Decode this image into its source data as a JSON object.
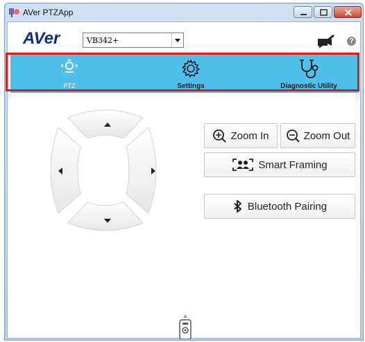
{
  "window": {
    "title": "AVer PTZApp"
  },
  "header": {
    "logo_text": "AVer",
    "device_select": {
      "value": "VB342+"
    },
    "camera_icon": "camera-off-icon",
    "help_label": "?"
  },
  "tabs": [
    {
      "label": "PTZ",
      "icon": "ptz-icon",
      "active": true
    },
    {
      "label": "Settings",
      "icon": "gear-icon",
      "active": false
    },
    {
      "label": "Diagnostic Utility",
      "icon": "stethoscope-icon",
      "active": false
    }
  ],
  "colors": {
    "tab_bar": "#4fc0ec",
    "highlight": "#e21818"
  },
  "ptz": {
    "zoom_in_label": "Zoom In",
    "zoom_out_label": "Zoom Out",
    "smart_framing_label": "Smart Framing",
    "bluetooth_pairing_label": "Bluetooth Pairing"
  },
  "footer": {
    "remote_icon": "remote-control-icon"
  }
}
